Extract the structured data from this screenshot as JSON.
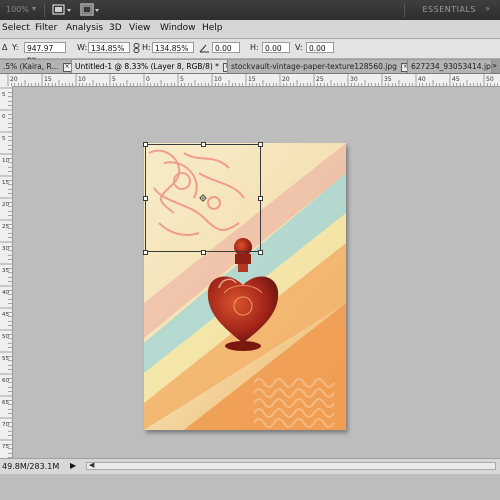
{
  "appbar": {
    "zoom_value": "100%",
    "workspace_label": "ESSENTIALS",
    "icons": [
      "zoom-dropdown-caret",
      "screen-mode-icon",
      "arrange-documents-icon"
    ]
  },
  "menubar": {
    "items": [
      "Select",
      "Filter",
      "Analysis",
      "3D",
      "View",
      "Window",
      "Help"
    ]
  },
  "options": {
    "y_label": "Y:",
    "y_value": "947.97 px",
    "w_label": "W:",
    "w_value": "134.85%",
    "h_label": "H:",
    "h_value": "134.85%",
    "angle_value": "0.00",
    "hskew_label": "H:",
    "hskew_value": "0.00",
    "vskew_label": "V:",
    "vskew_value": "0.00",
    "delta_label": "Δ"
  },
  "tabs": [
    {
      "label": ".5% (Kaira, R...",
      "active": false
    },
    {
      "label": "Untitled-1 @ 8.33% (Layer 8, RGB/8) *",
      "active": true
    },
    {
      "label": "stockvault-vintage-paper-texture128560.jpg",
      "active": false
    },
    {
      "label": "627234_93053414.jpg",
      "active": false
    }
  ],
  "tabs_more": "»",
  "ruler": {
    "h_labels": [
      "20",
      "15",
      "10",
      "5",
      "0",
      "5",
      "10",
      "15",
      "20",
      "25",
      "30",
      "35",
      "40",
      "45",
      "50"
    ],
    "v_labels": [
      "5",
      "0",
      "5",
      "10",
      "15",
      "20",
      "25",
      "30",
      "35",
      "40",
      "45",
      "50",
      "55",
      "60",
      "65",
      "70",
      "75"
    ]
  },
  "status": {
    "doc_size": "49.8M/283.1M",
    "arrow": "▶",
    "scroll_left": "◀"
  },
  "colors": {
    "appbar": "#333333",
    "menubar": "#d6d6d6",
    "canvas_bg": "#bdbdbd",
    "bottle_red": "#a4261a"
  }
}
